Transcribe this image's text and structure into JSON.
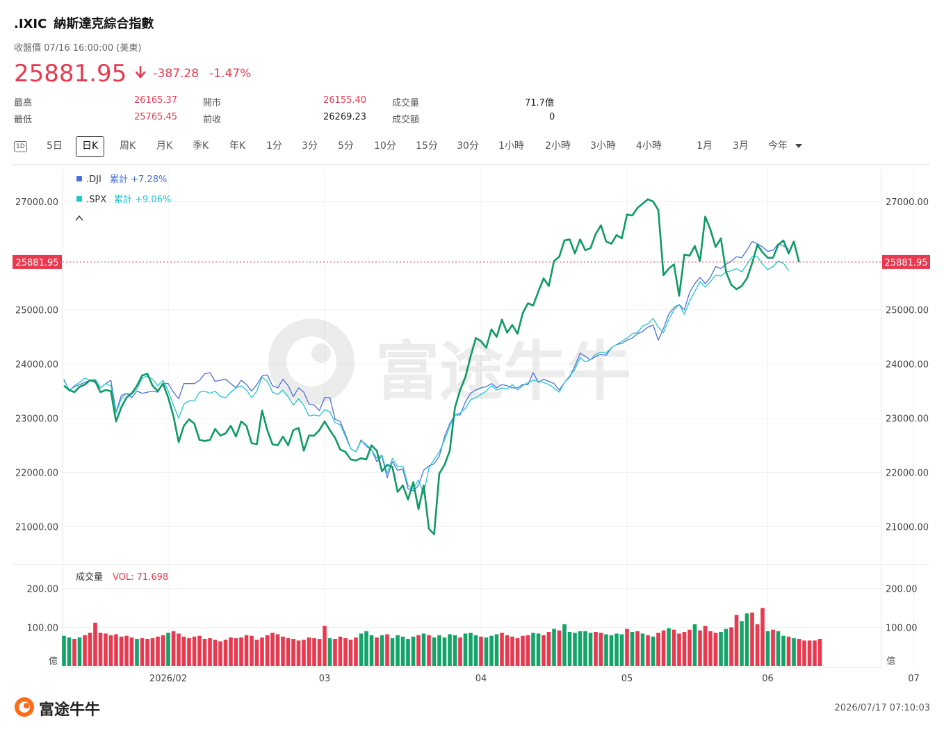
{
  "header": {
    "symbol": ".IXIC",
    "name": "納斯達克綜合指數",
    "subtitle": "收盤價 07/16 16:00:00 (美東)",
    "price": "25881.95",
    "change": "-387.28",
    "change_pct": "-1.47%"
  },
  "stats": {
    "high_label": "最高",
    "high": "26165.37",
    "low_label": "最低",
    "low": "25765.45",
    "open_label": "開市",
    "open": "26155.40",
    "prev_label": "前收",
    "prev": "26269.23",
    "vol_label": "成交量",
    "vol": "71.7億",
    "turnover_label": "成交額",
    "turnover": "0"
  },
  "tabs": [
    "5日",
    "日K",
    "周K",
    "月K",
    "季K",
    "年K",
    "1分",
    "3分",
    "5分",
    "10分",
    "15分",
    "30分",
    "1小時",
    "2小時",
    "3小時",
    "4小時",
    "1月",
    "3月",
    "今年"
  ],
  "tab_icon_label": "1D",
  "active_tab": "日K",
  "legend": {
    "dji_name": ".DJI",
    "dji_text": "累計 +7.28%",
    "spx_name": ".SPX",
    "spx_text": "累計 +9.06%"
  },
  "volume_panel": {
    "label": "成交量",
    "vol_text": "VOL: 71.698",
    "unit": "億"
  },
  "footer": {
    "brand": "富途牛牛",
    "timestamp": "2026/07/17 07:10:03"
  },
  "watermark": "富途牛牛",
  "colors": {
    "ixic": "#0d9a63",
    "dji": "#4a6fe0",
    "spx": "#22c6cf",
    "up": "#e8394f",
    "down": "#14a46a",
    "price_line": "#e8394f"
  },
  "chart_data": [
    {
      "type": "line",
      "ylim": [
        20300,
        27600
      ],
      "yticks": [
        21000,
        22000,
        23000,
        24000,
        25000,
        27000
      ],
      "ytick_labels": [
        "21000.00",
        "22000.00",
        "23000.00",
        "24000.00",
        "25000.00",
        "27000.00"
      ],
      "x_labels": [
        "2026/02",
        "03",
        "04",
        "05",
        "06",
        "07"
      ],
      "x_label_index": [
        20,
        50,
        80,
        108,
        135,
        163
      ],
      "current_price_label": "25881.95",
      "current_price": 25881.95,
      "series": [
        {
          "name": ".IXIC",
          "values": [
            23600,
            23520,
            23480,
            23580,
            23620,
            23700,
            23680,
            23480,
            23520,
            23500,
            22940,
            23200,
            23380,
            23460,
            23600,
            23790,
            23820,
            23600,
            23500,
            23640,
            23380,
            23040,
            22560,
            22860,
            22980,
            22900,
            22600,
            22580,
            22600,
            22800,
            22680,
            22720,
            22860,
            22660,
            22940,
            22860,
            22540,
            22520,
            23140,
            22780,
            22520,
            22500,
            22660,
            22500,
            22780,
            22820,
            22400,
            22680,
            22680,
            22780,
            22940,
            22780,
            22640,
            22420,
            22380,
            22240,
            22220,
            22260,
            22240,
            22500,
            22400,
            22020,
            22140,
            22100,
            21640,
            21760,
            21500,
            21820,
            21320,
            21760,
            20960,
            20860,
            21980,
            22140,
            22400,
            23200,
            23520,
            23760,
            24140,
            24480,
            24420,
            24300,
            24640,
            24500,
            24820,
            24580,
            24720,
            24560,
            24940,
            25120,
            25080,
            25340,
            25580,
            25440,
            25900,
            25980,
            26280,
            26300,
            26040,
            26300,
            26100,
            26140,
            26400,
            26560,
            26260,
            26220,
            26380,
            26320,
            26760,
            26740,
            26880,
            26960,
            27040,
            27000,
            26840,
            25640,
            25760,
            25840,
            25260,
            26020,
            26000,
            26180,
            25900,
            26720,
            26480,
            26160,
            26320,
            25700,
            25460,
            25380,
            25440,
            25580,
            25860,
            26200,
            26060,
            25960,
            25960,
            26200,
            26280,
            26040,
            26260,
            25881.95
          ]
        },
        {
          "name": ".DJI",
          "values": [
            23700,
            23520,
            23580,
            23620,
            23660,
            23700,
            23660,
            23560,
            23640,
            23700,
            23120,
            23420,
            23460,
            23380,
            23500,
            23460,
            23480,
            23500,
            23480,
            23640,
            23640,
            23480,
            23360,
            23640,
            23640,
            23640,
            23700,
            23820,
            23840,
            23680,
            23700,
            23720,
            23640,
            23560,
            23700,
            23620,
            23500,
            23620,
            23780,
            23800,
            23600,
            23560,
            23720,
            23600,
            23400,
            23560,
            23480,
            23260,
            23240,
            23140,
            23380,
            23380,
            22980,
            22940,
            22700,
            22440,
            22380,
            22600,
            22480,
            22420,
            22200,
            22300,
            21900,
            22200,
            22040,
            22060,
            21700,
            21660,
            21760,
            22040,
            22120,
            22160,
            22300,
            22660,
            22900,
            23060,
            23060,
            23300,
            23460,
            23520,
            23560,
            23580,
            23640,
            23560,
            23620,
            23600,
            23560,
            23560,
            23620,
            23620,
            23840,
            23660,
            23720,
            23680,
            23640,
            23520,
            23660,
            23760,
            23960,
            24200,
            24140,
            24080,
            24140,
            24180,
            24160,
            24300,
            24360,
            24380,
            24440,
            24480,
            24560,
            24600,
            24680,
            24720,
            24440,
            24660,
            24920,
            25040,
            25100,
            25000,
            25320,
            25480,
            25600,
            25480,
            25600,
            25800,
            25760,
            25840,
            25900,
            25980,
            25960,
            26100,
            26260,
            26220,
            26160,
            26080,
            26100,
            26220,
            26180,
            26120
          ]
        },
        {
          "name": ".SPX",
          "values": [
            23720,
            23500,
            23600,
            23660,
            23740,
            23700,
            23720,
            23560,
            23640,
            23600,
            23100,
            23360,
            23460,
            23440,
            23540,
            23740,
            23780,
            23720,
            23600,
            23700,
            23500,
            23240,
            23000,
            23260,
            23320,
            23320,
            23480,
            23500,
            23460,
            23500,
            23400,
            23380,
            23480,
            23560,
            23600,
            23520,
            23380,
            23500,
            23760,
            23680,
            23480,
            23440,
            23520,
            23400,
            23240,
            23360,
            23240,
            23040,
            23060,
            23040,
            23160,
            23120,
            22920,
            22880,
            22660,
            22440,
            22380,
            22580,
            22520,
            22420,
            22260,
            22320,
            21980,
            22260,
            22100,
            22120,
            21760,
            21700,
            21860,
            21600,
            22080,
            22240,
            22380,
            22600,
            22840,
            23060,
            23100,
            23180,
            23340,
            23380,
            23440,
            23500,
            23600,
            23520,
            23560,
            23540,
            23620,
            23520,
            23600,
            23660,
            23700,
            23680,
            23660,
            23620,
            23560,
            23480,
            23660,
            23780,
            23900,
            24120,
            24040,
            24080,
            24180,
            24220,
            24200,
            24300,
            24360,
            24420,
            24480,
            24560,
            24580,
            24700,
            24740,
            24840,
            24680,
            24580,
            24820,
            25000,
            25100,
            24920,
            25160,
            25340,
            25520,
            25420,
            25520,
            25640,
            25620,
            25700,
            25720,
            25760,
            25700,
            25840,
            25980,
            25980,
            25840,
            25740,
            25800,
            25900,
            25860,
            25720
          ]
        }
      ]
    },
    {
      "type": "bar",
      "title": "成交量",
      "ylim": [
        0,
        230
      ],
      "yticks": [
        100,
        200
      ],
      "ytick_labels": [
        "100.00",
        "200.00"
      ],
      "values": [
        78,
        74,
        70,
        74,
        80,
        86,
        112,
        86,
        84,
        80,
        82,
        76,
        78,
        74,
        70,
        72,
        70,
        72,
        76,
        80,
        86,
        90,
        84,
        76,
        72,
        76,
        78,
        70,
        72,
        68,
        64,
        68,
        74,
        72,
        74,
        80,
        78,
        68,
        74,
        80,
        86,
        82,
        76,
        72,
        70,
        66,
        68,
        74,
        72,
        70,
        104,
        72,
        70,
        76,
        72,
        68,
        74,
        84,
        90,
        80,
        74,
        80,
        82,
        72,
        80,
        76,
        70,
        76,
        80,
        84,
        80,
        74,
        80,
        74,
        82,
        80,
        74,
        84,
        86,
        80,
        76,
        74,
        78,
        82,
        86,
        80,
        76,
        72,
        78,
        80,
        86,
        84,
        80,
        88,
        96,
        92,
        108,
        88,
        86,
        90,
        90,
        86,
        88,
        86,
        82,
        80,
        84,
        82,
        96,
        88,
        90,
        84,
        80,
        76,
        86,
        92,
        98,
        94,
        84,
        88,
        94,
        108,
        92,
        104,
        90,
        86,
        88,
        96,
        100,
        132,
        116,
        136,
        138,
        108,
        150,
        90,
        94,
        90,
        78,
        76,
        72,
        70,
        66,
        66,
        66,
        70
      ],
      "colors": [
        "down",
        "down",
        "up",
        "down",
        "up",
        "up",
        "up",
        "up",
        "up",
        "up",
        "up",
        "up",
        "up",
        "up",
        "down",
        "up",
        "up",
        "up",
        "up",
        "up",
        "down",
        "up",
        "up",
        "up",
        "up",
        "up",
        "up",
        "up",
        "up",
        "up",
        "up",
        "up",
        "up",
        "up",
        "up",
        "up",
        "up",
        "up",
        "up",
        "up",
        "up",
        "up",
        "up",
        "up",
        "up",
        "up",
        "up",
        "up",
        "up",
        "up",
        "up",
        "down",
        "up",
        "up",
        "up",
        "up",
        "up",
        "down",
        "down",
        "down",
        "up",
        "down",
        "up",
        "down",
        "down",
        "down",
        "down",
        "down",
        "up",
        "down",
        "up",
        "down",
        "down",
        "down",
        "down",
        "down",
        "up",
        "down",
        "down",
        "down",
        "up",
        "down",
        "down",
        "down",
        "up",
        "up",
        "up",
        "up",
        "up",
        "up",
        "down",
        "down",
        "up",
        "up",
        "down",
        "up",
        "down",
        "down",
        "down",
        "down",
        "down",
        "down",
        "up",
        "up",
        "down",
        "down",
        "down",
        "down",
        "up",
        "down",
        "up",
        "down",
        "up",
        "down",
        "up",
        "up",
        "down",
        "up",
        "up",
        "up",
        "up",
        "down",
        "up",
        "up",
        "up",
        "up",
        "down",
        "down",
        "up",
        "up",
        "down",
        "down",
        "up",
        "up",
        "up",
        "down",
        "up",
        "down",
        "down",
        "up",
        "down",
        "up",
        "up",
        "up",
        "up",
        "up",
        "up",
        "up",
        "up",
        "up",
        "up",
        "up"
      ]
    }
  ]
}
